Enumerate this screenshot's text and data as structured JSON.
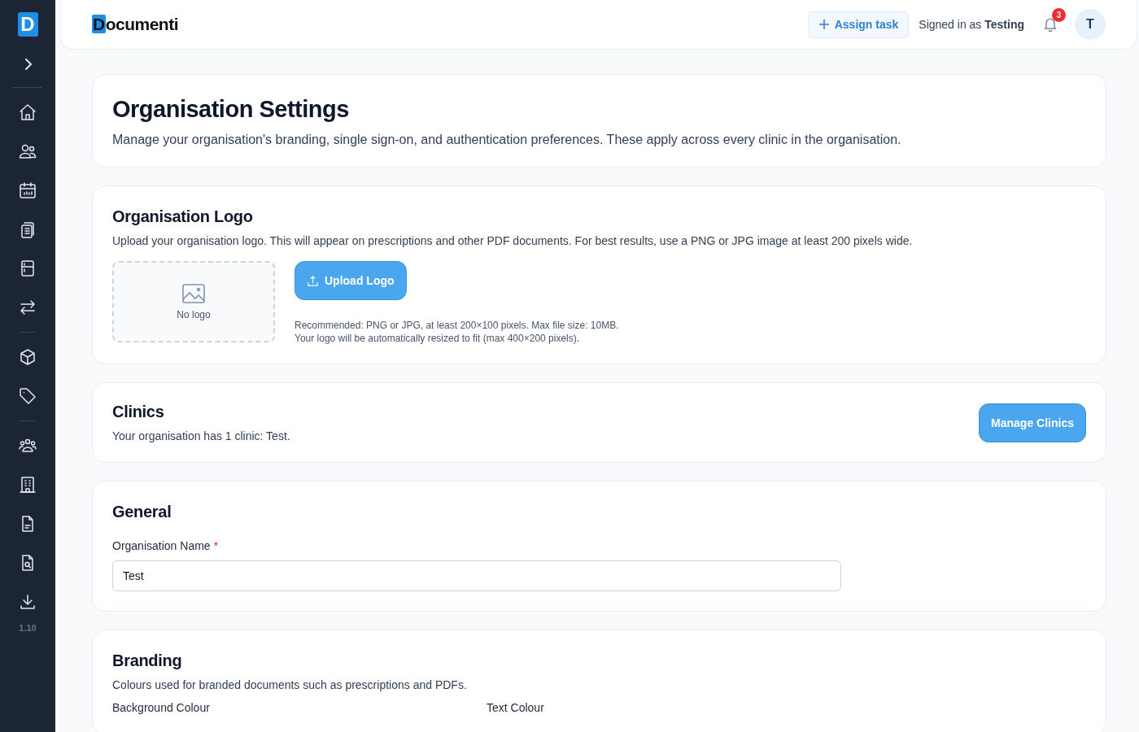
{
  "sidebar": {
    "logo": "D",
    "version": "1.10"
  },
  "header": {
    "brand": "Documenti",
    "assign_button": "Assign task",
    "signed_in": "Signed in as **Testing**",
    "notification_count": "3",
    "avatar": "T"
  },
  "page": {
    "title": "Organisation Settings",
    "description": "Manage your organisation's branding, single sign-on, and authentication preferences. These apply across every clinic in the organisation."
  },
  "logo_section": {
    "title": "Organisation Logo",
    "description": "Upload your organisation logo. This will appear on prescriptions and other PDF documents. For best results, use a PNG or JPG image at least 200 pixels wide.",
    "placeholder": "No logo",
    "button": "Upload Logo",
    "hints": [
      "Recommended: PNG or JPG, at least 200×100 pixels. Max file size: 10MB.",
      "Your logo will be automatically resized to fit (max 400×200 pixels)."
    ]
  },
  "clinics_section": {
    "title": "Clinics",
    "description": "Your organisation has 1 clinic: Test.",
    "button": "Manage Clinics"
  },
  "general_section": {
    "title": "General",
    "field_label": "Organisation Name",
    "required_mark": "*",
    "value": "Test"
  },
  "branding_section": {
    "title": "Branding",
    "description": "Colours used for branded documents such as prescriptions and PDFs.",
    "field_labels": [
      "Background Colour",
      "Text Colour"
    ]
  }
}
